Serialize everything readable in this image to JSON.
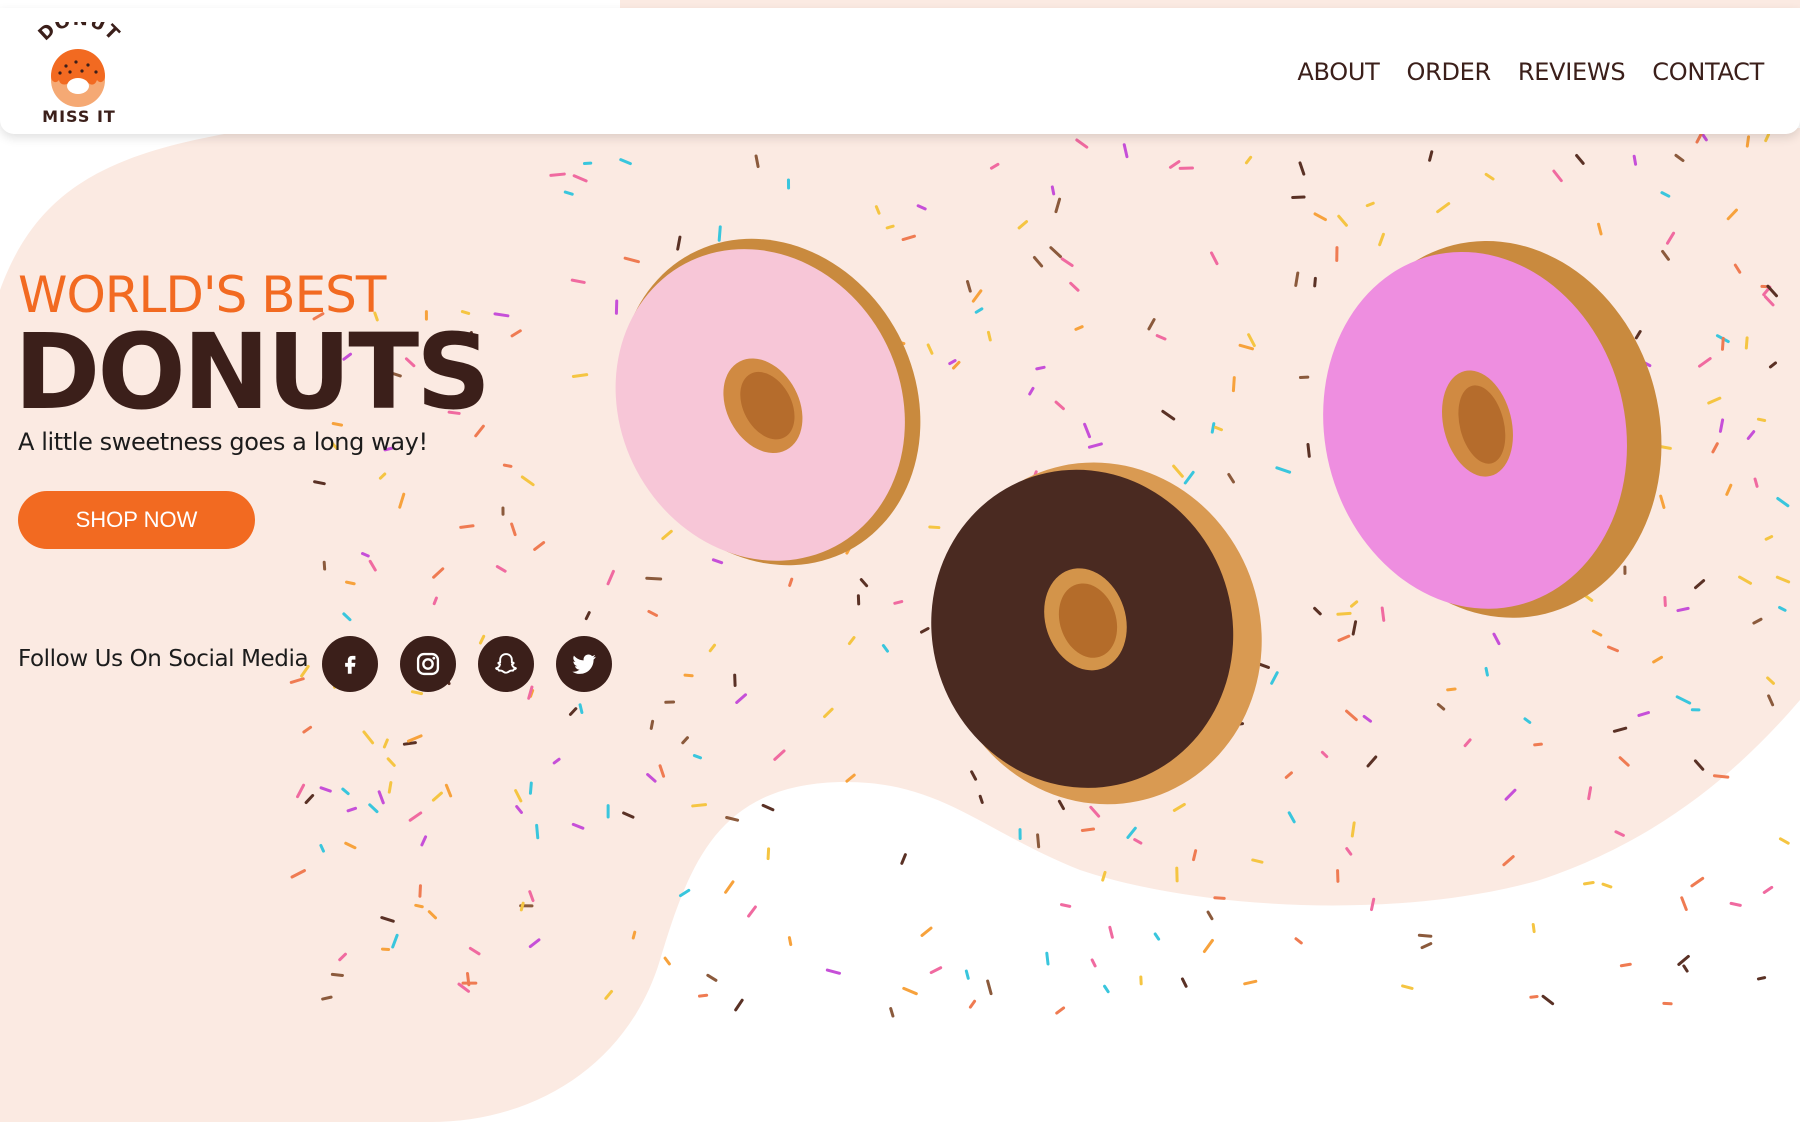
{
  "brand": {
    "logo_top": "DONUT",
    "logo_bottom": "MISS IT"
  },
  "nav": {
    "items": [
      "ABOUT",
      "ORDER",
      "REVIEWS",
      "CONTACT"
    ]
  },
  "hero": {
    "kicker": "WORLD'S BEST",
    "title": "DONUTS",
    "subtitle": "A little sweetness goes a long way!",
    "cta_label": "SHOP NOW"
  },
  "social": {
    "label": "Follow Us On Social Media",
    "icons": [
      "facebook-icon",
      "instagram-icon",
      "snapchat-icon",
      "twitter-icon"
    ]
  },
  "colors": {
    "accent": "#f26a21",
    "brown": "#3b1f1a",
    "cream": "#fbeae2"
  }
}
